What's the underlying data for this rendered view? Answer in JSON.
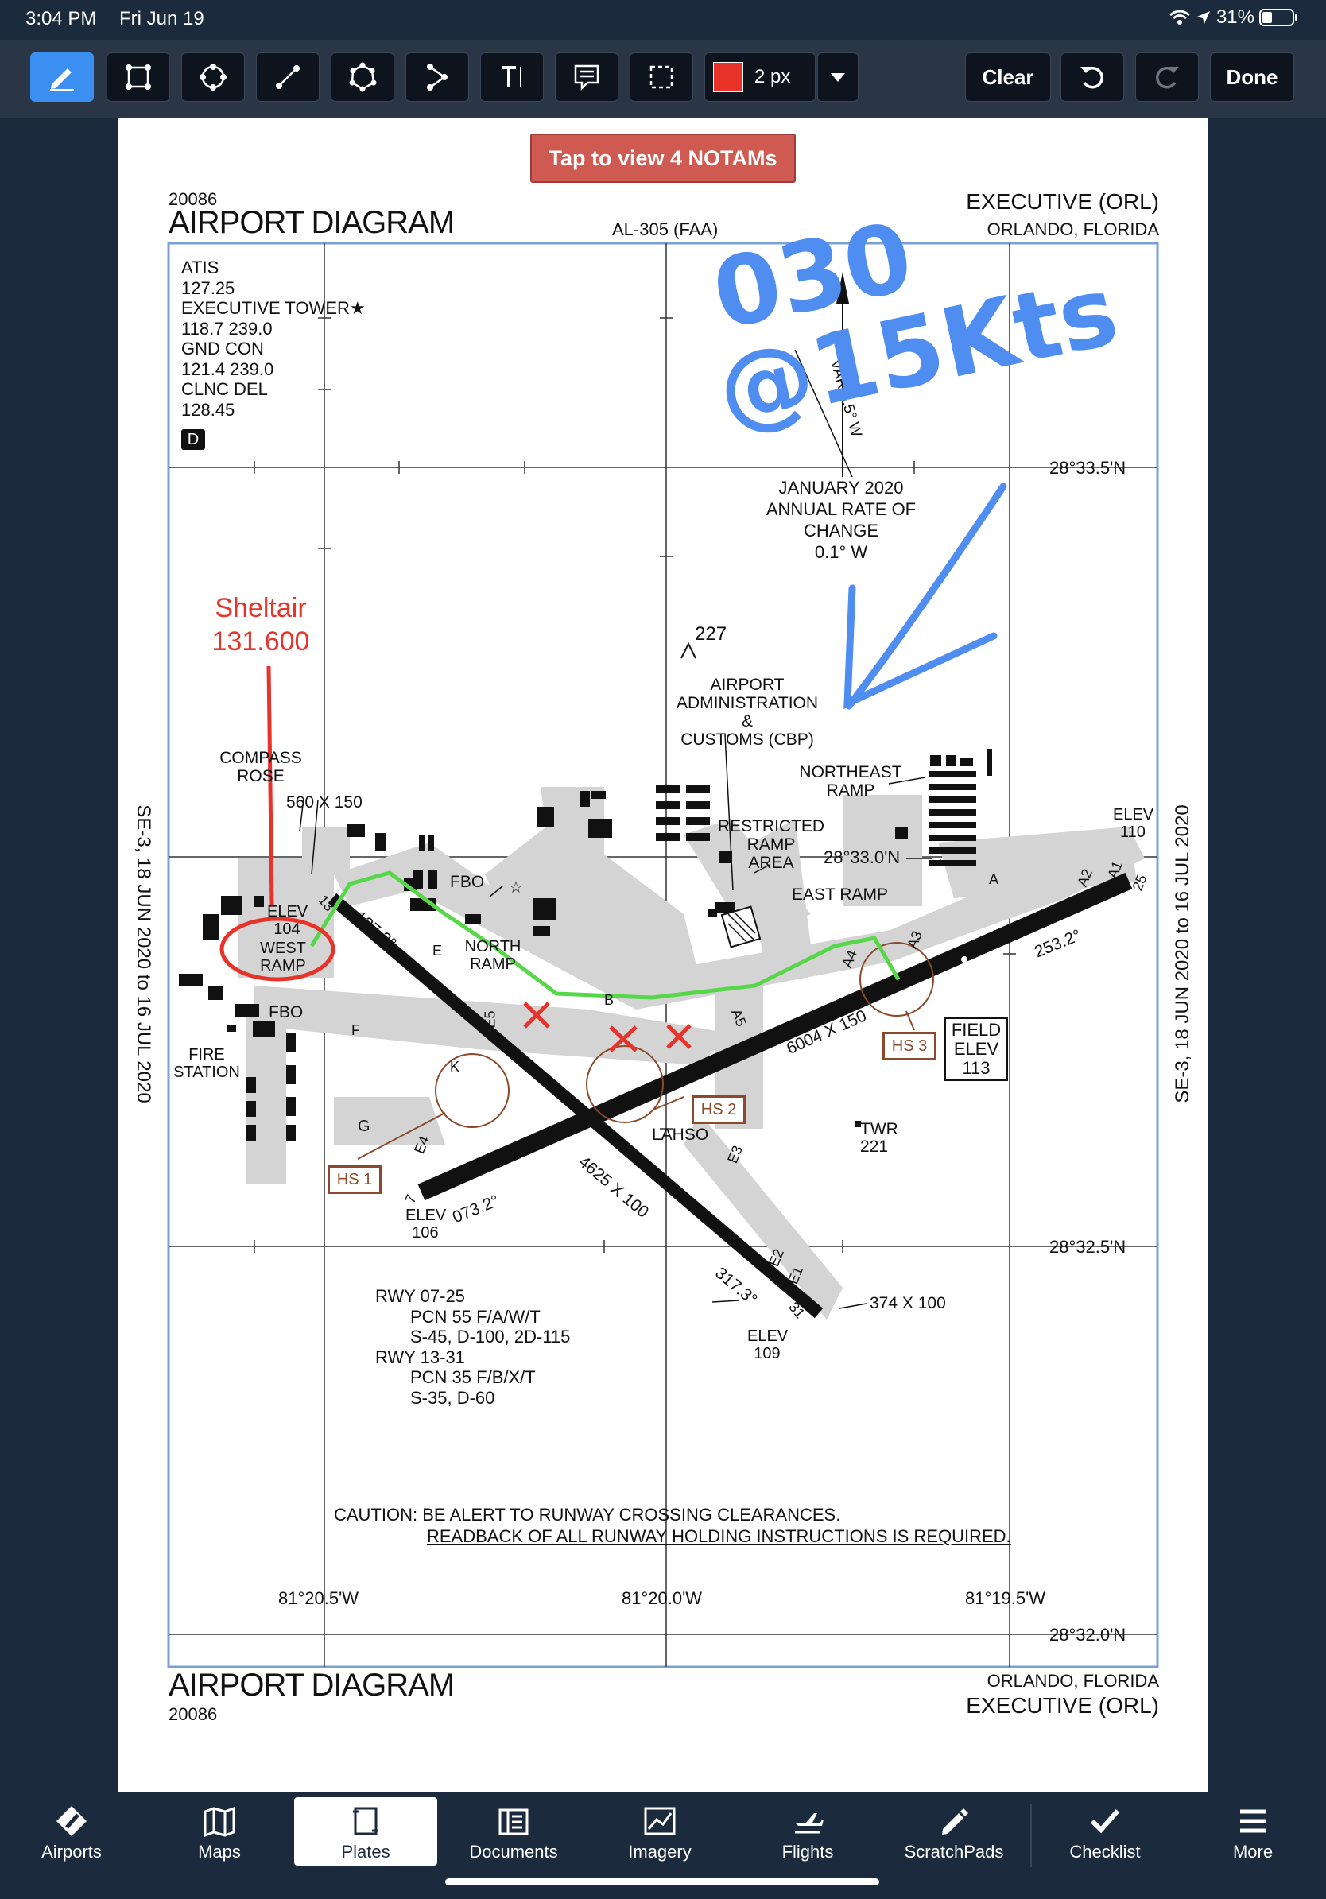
{
  "status_bar": {
    "time": "3:04 PM",
    "date": "Fri Jun 19",
    "battery": "31%"
  },
  "toolbar": {
    "tools": [
      "pen-icon",
      "rect-icon",
      "ellipse-icon",
      "line-icon",
      "polygon-icon",
      "polyline-icon",
      "text-icon",
      "note-icon",
      "select-icon"
    ],
    "color": "#e8332b",
    "stroke_width": "2 px",
    "clear": "Clear",
    "done": "Done"
  },
  "notams": "Tap to view 4 NOTAMs",
  "plate": {
    "id_top": "20086",
    "title_top": "AIRPORT DIAGRAM",
    "doc_id": "AL-305 (FAA)",
    "airport_name": "EXECUTIVE (ORL)",
    "city": "ORLANDO, FLORIDA",
    "title_bottom": "AIRPORT DIAGRAM",
    "id_bottom": "20086",
    "city_bottom": "ORLANDO, FLORIDA",
    "airport_name_bottom": "EXECUTIVE (ORL)",
    "side_label_left": "SE-3,  18 JUN 2020  to  16 JUL 2020",
    "side_label_right": "SE-3,  18 JUN 2020  to  16 JUL 2020",
    "freqs": [
      "ATIS",
      "127.25",
      "EXECUTIVE TOWER",
      "118.7 239.0",
      "GND CON",
      "121.4  239.0",
      "CLNC DEL",
      "128.45"
    ],
    "airspace": "D",
    "variation": "VAR 6.5° W",
    "variation_note": [
      "JANUARY 2020",
      "ANNUAL RATE OF CHANGE",
      "0.1° W"
    ],
    "lat_labels": [
      "28°33.5'N",
      "28°33.0'N",
      "28°32.5'N",
      "28°32.0'N"
    ],
    "lon_labels": [
      "81°20.5'W",
      "81°20.0'W",
      "81°19.5'W"
    ],
    "obstacle": "227",
    "admin": [
      "AIRPORT",
      "ADMINISTRATION",
      "&",
      "CUSTOMS (CBP)"
    ],
    "northeast_ramp": [
      "NORTHEAST",
      "RAMP"
    ],
    "restricted": [
      "RESTRICTED",
      "RAMP",
      "AREA"
    ],
    "east_ramp": "EAST RAMP",
    "compass": [
      "COMPASS",
      "ROSE"
    ],
    "compass_dims": "560 X 150",
    "elev_104": [
      "ELEV",
      "104"
    ],
    "west_ramp": [
      "WEST",
      "RAMP"
    ],
    "fbo": "FBO",
    "fbo2": "FBO",
    "north_ramp": [
      "NORTH",
      "RAMP"
    ],
    "fire": [
      "FIRE",
      "STATION"
    ],
    "elev_110": [
      "ELEV",
      "110"
    ],
    "field_elev": [
      "FIELD",
      "ELEV",
      "113"
    ],
    "twr": [
      "TWR",
      "221"
    ],
    "lahso": "LAHSO",
    "hs": [
      "HS 1",
      "HS 2",
      "HS 3"
    ],
    "rwy_0725_dims": "6004 X 150",
    "rwy_1331_dims": "4625 X 100",
    "hdg_253": "253.2°",
    "hdg_073": "073.2°",
    "hdg_137": "137.3°",
    "hdg_317": "317.3°",
    "elev_106": [
      "ELEV",
      "106"
    ],
    "elev_109": [
      "ELEV",
      "109"
    ],
    "rwy_374": "374 X 100",
    "rwy_ends": [
      "7",
      "25",
      "13",
      "31"
    ],
    "taxiways": [
      "A",
      "B",
      "E",
      "F",
      "G",
      "K",
      "A1",
      "A2",
      "A3",
      "A4",
      "A5",
      "E1",
      "E2",
      "E3",
      "E4",
      "E5"
    ],
    "rwy_data": [
      "RWY 07-25",
      "PCN 55 F/A/W/T",
      "S-45, D-100, 2D-115",
      "RWY 13-31",
      "PCN 35 F/B/X/T",
      "S-35, D-60"
    ],
    "caution": [
      "CAUTION: BE ALERT TO RUNWAY CROSSING CLEARANCES.",
      "READBACK OF ALL RUNWAY HOLDING INSTRUCTIONS IS REQUIRED."
    ]
  },
  "annotations": {
    "wind": [
      "030",
      "@15Kts"
    ],
    "sheltair": [
      "Sheltair",
      "131.600"
    ]
  },
  "tabs": [
    {
      "label": "Airports",
      "icon": "airports-icon"
    },
    {
      "label": "Maps",
      "icon": "maps-icon"
    },
    {
      "label": "Plates",
      "icon": "plates-icon"
    },
    {
      "label": "Documents",
      "icon": "documents-icon"
    },
    {
      "label": "Imagery",
      "icon": "imagery-icon"
    },
    {
      "label": "Flights",
      "icon": "flights-icon"
    },
    {
      "label": "ScratchPads",
      "icon": "scratchpads-icon"
    },
    {
      "label": "Checklist",
      "icon": "checklist-icon"
    },
    {
      "label": "More",
      "icon": "more-icon"
    }
  ],
  "active_tab": "Plates"
}
